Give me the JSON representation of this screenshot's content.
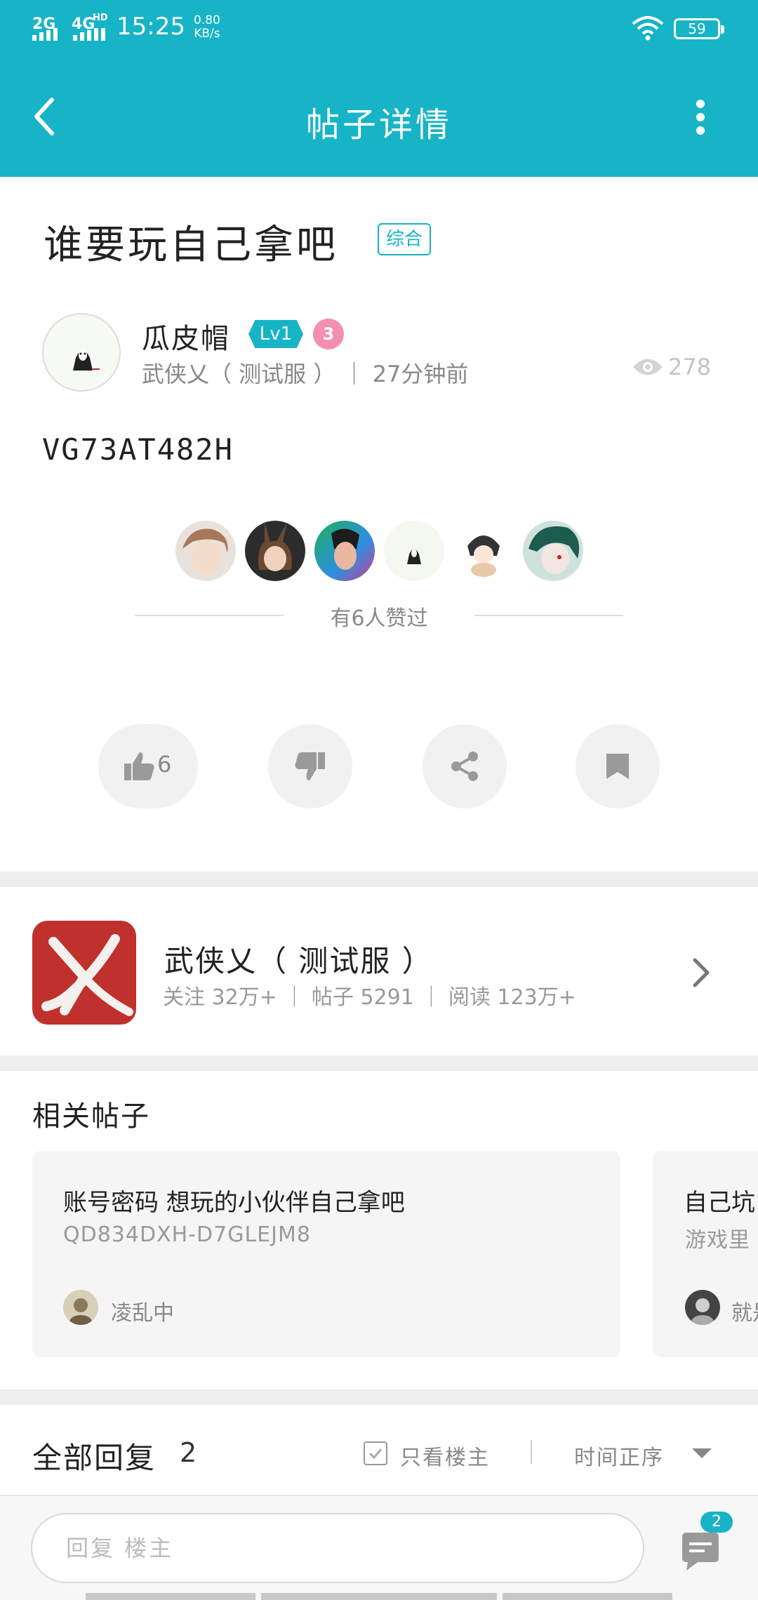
{
  "status_bar": {
    "signal_1": "2G",
    "signal_2": "4G",
    "hd": "HD",
    "time": "15:25",
    "speed_value": "0.80",
    "speed_unit": "KB/s",
    "battery": "59"
  },
  "app_bar": {
    "title": "帖子详情",
    "back_icon": "chevron-left-icon",
    "more_icon": "more-vertical-icon"
  },
  "post": {
    "title": "谁要玩自己拿吧",
    "tag": "综合",
    "author": "瓜皮帽",
    "level": "Lv1",
    "medal": "3",
    "meta": "武侠乂（ 测试服 ） ｜ 27分钟前",
    "views": "278",
    "body": "VG73AT482H",
    "liked_text": "有6人赞过",
    "like_count": "6"
  },
  "actions": {
    "like_icon": "thumb-up-icon",
    "dislike_icon": "thumb-down-icon",
    "share_icon": "share-icon",
    "bookmark_icon": "bookmark-icon"
  },
  "game": {
    "name": "武侠乂（ 测试服 ）",
    "stats": "关注 32万+ ｜ 帖子 5291 ｜ 阅读 123万+"
  },
  "related": {
    "title": "相关帖子",
    "cards": [
      {
        "title": "账号密码 想玩的小伙伴自己拿吧",
        "subtitle": "QD834DXH-D7GLEJM8",
        "user": "凌乱中"
      },
      {
        "title": "自己坑",
        "subtitle": "游戏里",
        "user": "就是"
      }
    ]
  },
  "replies": {
    "title": "全部回复",
    "count": "2",
    "only_host": "只看楼主",
    "sort": "时间正序"
  },
  "bottom": {
    "reply_placeholder": "回复  楼主",
    "comment_badge": "2"
  },
  "colors": {
    "accent": "#16b4c6",
    "game_icon_bg": "#c0302c"
  }
}
